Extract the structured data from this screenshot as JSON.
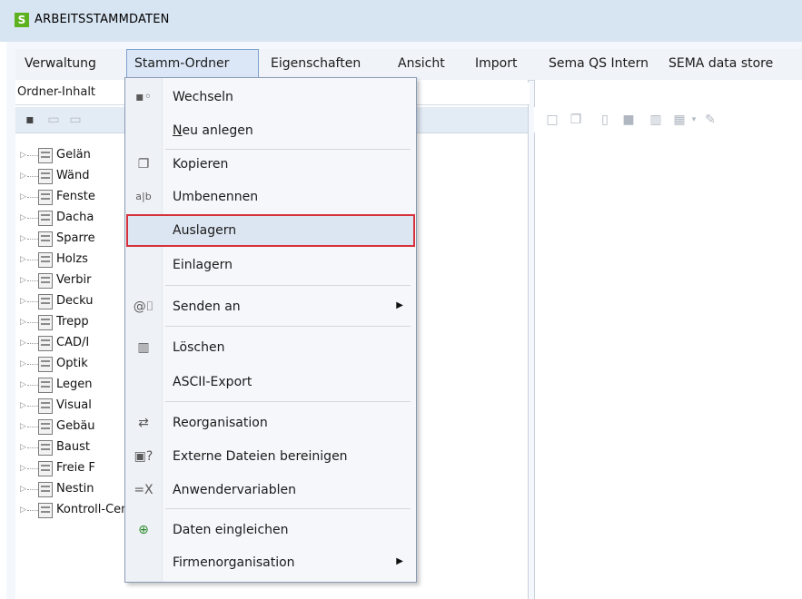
{
  "window": {
    "title": "ARBEITSSTAMMDATEN",
    "logo_letter": "S",
    "logo_color": "#5cb11f"
  },
  "menubar": {
    "items": [
      {
        "label": "Verwaltung"
      },
      {
        "label": "Stamm-Ordner"
      },
      {
        "label": "Eigenschaften"
      },
      {
        "label": "Ansicht"
      },
      {
        "label": "Import"
      },
      {
        "label": "Sema QS Intern"
      },
      {
        "label": "SEMA data store"
      }
    ]
  },
  "left_panel": {
    "header": "Ordner-Inhalt",
    "tree": [
      {
        "label": "Gelän"
      },
      {
        "label": "Wänd"
      },
      {
        "label": "Fenste"
      },
      {
        "label": "Dacha"
      },
      {
        "label": "Sparre"
      },
      {
        "label": "Holzs"
      },
      {
        "label": "Verbir"
      },
      {
        "label": "Decku"
      },
      {
        "label": "Trepp"
      },
      {
        "label": "CAD/I"
      },
      {
        "label": "Optik"
      },
      {
        "label": "Legen"
      },
      {
        "label": "Visual"
      },
      {
        "label": "Gebäu"
      },
      {
        "label": "Baust"
      },
      {
        "label": "Freie F"
      },
      {
        "label": "Nestin"
      },
      {
        "label": "Kontroll-Center"
      }
    ]
  },
  "dropdown": {
    "items": [
      {
        "label": "Wechseln",
        "icon": "switch-icon"
      },
      {
        "label": "Neu anlegen",
        "icon": ""
      },
      {
        "label": "Kopieren",
        "icon": "copy-icon"
      },
      {
        "label": "Umbenennen",
        "icon": "rename-icon"
      },
      {
        "label": "Auslagern",
        "icon": "",
        "highlighted": true
      },
      {
        "label": "Einlagern",
        "icon": ""
      },
      {
        "label": "Senden an",
        "icon": "attachment-icon",
        "submenu": true
      },
      {
        "label": "Löschen",
        "icon": "trash-icon"
      },
      {
        "label": "ASCII-Export",
        "icon": ""
      },
      {
        "label": "Reorganisation",
        "icon": "reorganize-icon"
      },
      {
        "label": "Externe Dateien bereinigen",
        "icon": "clean-files-icon"
      },
      {
        "label": "Anwendervariablen",
        "icon": "variable-icon"
      },
      {
        "label": "Daten eingleichen",
        "icon": "add-data-icon"
      },
      {
        "label": "Firmenorganisation",
        "icon": "",
        "submenu": true
      }
    ],
    "highlight_color": "#d6323c"
  }
}
